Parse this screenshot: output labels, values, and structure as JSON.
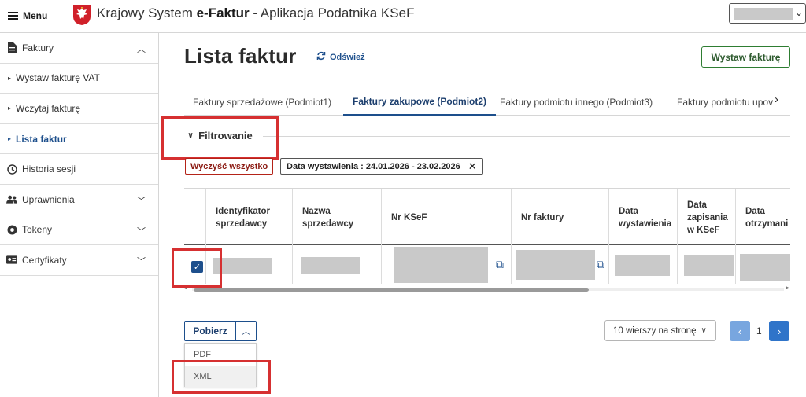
{
  "header": {
    "menu_label": "Menu",
    "app_title_prefix": "Krajowy System ",
    "app_title_brand": "e-Faktur",
    "app_title_suffix": " - Aplikacja Podatnika KSeF",
    "user_select_icon": "chevron-down-icon"
  },
  "sidebar": {
    "items": [
      {
        "label": "Faktury",
        "icon": "document-icon",
        "expanded": true
      },
      {
        "label": "Wystaw fakturę VAT",
        "sub": true
      },
      {
        "label": "Wczytaj fakturę",
        "sub": true
      },
      {
        "label": "Lista faktur",
        "sub": true,
        "active": true
      },
      {
        "label": "Historia sesji",
        "icon": "clock-icon"
      },
      {
        "label": "Uprawnienia",
        "icon": "users-icon"
      },
      {
        "label": "Tokeny",
        "icon": "token-icon"
      },
      {
        "label": "Certyfikaty",
        "icon": "certificate-icon"
      }
    ]
  },
  "main": {
    "title": "Lista faktur",
    "refresh_label": "Odśwież",
    "issue_button": "Wystaw fakturę",
    "tabs": [
      {
        "label": "Faktury sprzedażowe (Podmiot1)"
      },
      {
        "label": "Faktury zakupowe (Podmiot2)",
        "active": true
      },
      {
        "label": "Faktury podmiotu innego (Podmiot3)"
      },
      {
        "label": "Faktury podmiotu upov"
      }
    ],
    "filter_label": "Filtrowanie",
    "chips": {
      "clear_all": "Wyczyść wszystko",
      "date_filter": "Data wystawienia : 24.01.2026 - 23.02.2026"
    }
  },
  "table": {
    "columns": [
      "Identyfikator sprzedawcy",
      "Nazwa sprzedawcy",
      "Nr KSeF",
      "Nr faktury",
      "Data wystawienia",
      "Data zapisania w KSeF",
      "Data otrzymani"
    ],
    "rows": [
      {
        "checked": true
      }
    ]
  },
  "footer": {
    "download_label": "Pobierz",
    "download_options": [
      "PDF",
      "XML"
    ],
    "rows_per_page": "10 wierszy na stronę",
    "current_page": "1"
  },
  "colors": {
    "primary": "#1d4f8c",
    "success": "#2e7d32",
    "danger": "#b42318",
    "highlight_box": "#d63031"
  }
}
